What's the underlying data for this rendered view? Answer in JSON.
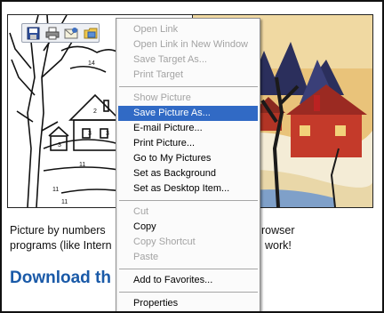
{
  "image_toolbar": {
    "icons": [
      "save-icon",
      "print-icon",
      "email-icon",
      "my-pictures-icon"
    ]
  },
  "context_menu": {
    "items": [
      {
        "label": "Open Link",
        "enabled": false
      },
      {
        "label": "Open Link in New Window",
        "enabled": false
      },
      {
        "label": "Save Target As...",
        "enabled": false
      },
      {
        "label": "Print Target",
        "enabled": false
      },
      {
        "separator": true
      },
      {
        "label": "Show Picture",
        "enabled": false
      },
      {
        "label": "Save Picture As...",
        "enabled": true,
        "highlighted": true
      },
      {
        "label": "E-mail Picture...",
        "enabled": true
      },
      {
        "label": "Print Picture...",
        "enabled": true
      },
      {
        "label": "Go to My Pictures",
        "enabled": true
      },
      {
        "label": "Set as Background",
        "enabled": true
      },
      {
        "label": "Set as Desktop Item...",
        "enabled": true
      },
      {
        "separator": true
      },
      {
        "label": "Cut",
        "enabled": false
      },
      {
        "label": "Copy",
        "enabled": true
      },
      {
        "label": "Copy Shortcut",
        "enabled": false
      },
      {
        "label": "Paste",
        "enabled": false
      },
      {
        "separator": true
      },
      {
        "label": "Add to Favorites...",
        "enabled": true
      },
      {
        "separator": true
      },
      {
        "label": "Properties",
        "enabled": true
      }
    ],
    "highlight_color": "#316ac5"
  },
  "page": {
    "paragraph": {
      "line1_left": "Picture by numbers",
      "line1_right": "rowser",
      "line2_left": "programs (like Intern",
      "line2_right": "work!"
    },
    "download_heading": "Download th",
    "link_color": "#1a5aa8"
  }
}
